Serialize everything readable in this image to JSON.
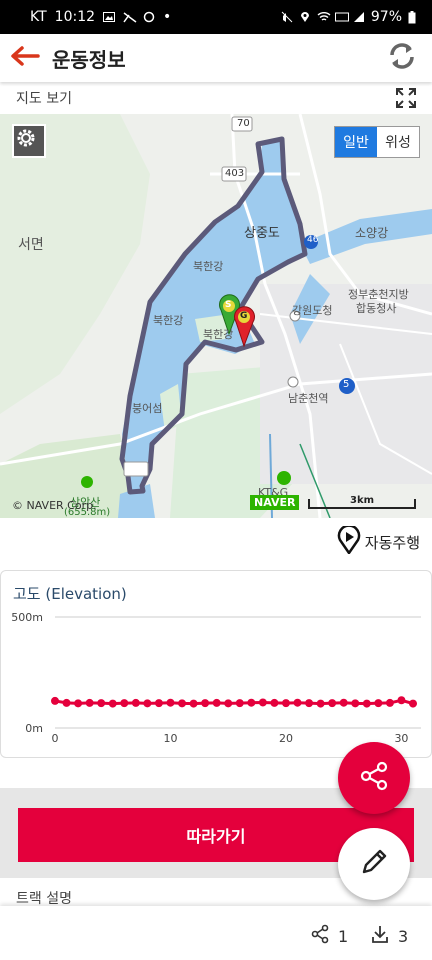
{
  "status_bar": {
    "carrier": "KT",
    "time": "10:12",
    "dot": "•",
    "battery": "97%"
  },
  "app_bar": {
    "title": "운동정보"
  },
  "map_section": {
    "label": "지도 보기",
    "toggle": {
      "normal": "일반",
      "satellite": "위성",
      "selected": "일반"
    },
    "labels": {
      "road_70": "70",
      "road_403": "403",
      "road_46": "46",
      "road_5": "5",
      "sangjungdo": "상중도",
      "seomyeon": "서면",
      "soyanggang": "소양강",
      "bukhangang1": "북한강",
      "bukhangang2": "북한강",
      "bukhangang3": "북한강",
      "gangwon": "강원도청",
      "chuncheon_gov": "정부춘천지방",
      "chuncheon_gov2": "합동청사",
      "namchuncheon": "남춘천역",
      "bungeoseom": "붕어섬",
      "samaksan": "삼악산",
      "samaksan_alt": "(655.8m)",
      "ktng": "KT&G"
    },
    "copyright": "© NAVER Corp.",
    "naver_badge": "NAVER",
    "scale": "3km",
    "markers": {
      "start": "S",
      "goal": "G"
    }
  },
  "autoplay_label": "자동주행",
  "elevation": {
    "title": "고도 (Elevation)"
  },
  "chart_data": {
    "type": "line",
    "title": "고도 (Elevation)",
    "xlabel": "",
    "ylabel": "",
    "x_ticks": [
      "0",
      "10",
      "20",
      "30"
    ],
    "y_ticks": [
      "0m",
      "500m"
    ],
    "xlim": [
      0,
      31
    ],
    "ylim": [
      0,
      500
    ],
    "series": [
      {
        "color": "#e4003c",
        "x": [
          0,
          1,
          2,
          3,
          4,
          5,
          6,
          7,
          8,
          9,
          10,
          11,
          12,
          13,
          14,
          15,
          16,
          17,
          18,
          19,
          20,
          21,
          22,
          23,
          24,
          25,
          26,
          27,
          28,
          29,
          30,
          31
        ],
        "y": [
          122,
          113,
          111,
          113,
          112,
          110,
          112,
          113,
          111,
          112,
          114,
          111,
          110,
          112,
          113,
          111,
          112,
          114,
          115,
          113,
          112,
          114,
          112,
          110,
          112,
          114,
          111,
          110,
          112,
          113,
          125,
          110
        ]
      }
    ]
  },
  "follow_button": "따라가기",
  "track_description": "트랙 설명",
  "bottom_bar": {
    "share_count": "1",
    "download_count": "3"
  },
  "colors": {
    "accent": "#e4003c",
    "route": "#5c5a7a",
    "water": "#9ecbee",
    "toggle_active": "#1f7ae0"
  }
}
